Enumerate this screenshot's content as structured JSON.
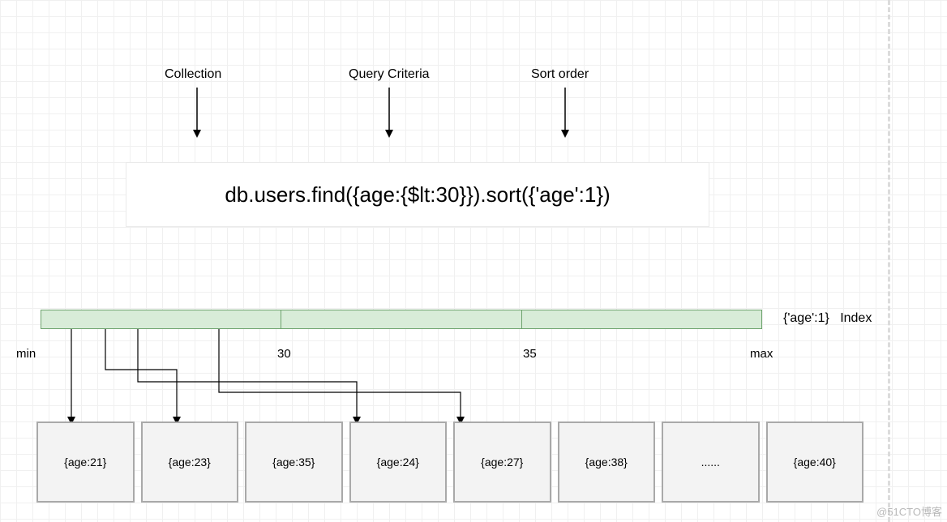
{
  "annotations": {
    "collection": "Collection",
    "query_criteria": "Query Criteria",
    "sort_order": "Sort order"
  },
  "query": "db.users.find({age:{$lt:30}}).sort({'age':1})",
  "index": {
    "label_spec": "{'age':1}",
    "label_word": "Index",
    "ticks": {
      "min": "min",
      "t1": "30",
      "t2": "35",
      "max": "max"
    }
  },
  "documents": [
    "{age:21}",
    "{age:23}",
    "{age:35}",
    "{age:24}",
    "{age:27}",
    "{age:38}",
    "......",
    "{age:40}"
  ],
  "watermark": "@51CTO博客"
}
